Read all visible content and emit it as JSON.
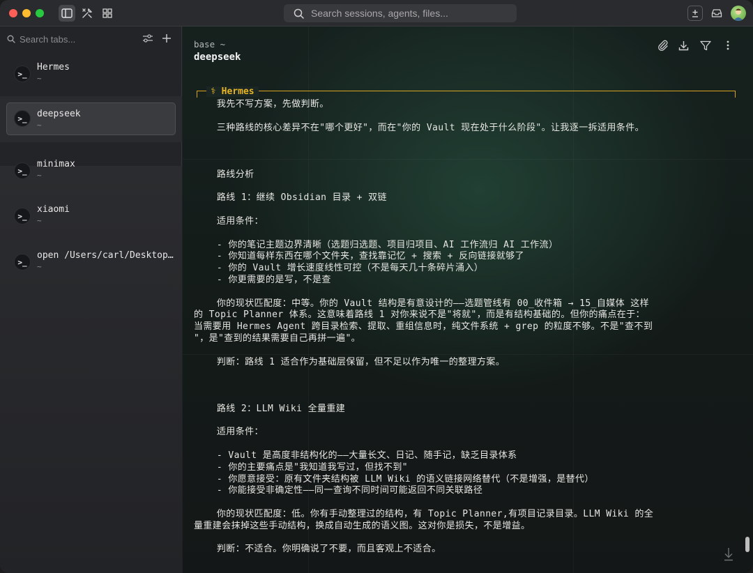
{
  "titlebar": {
    "search_placeholder": "Search sessions, agents, files..."
  },
  "sidebar": {
    "search_placeholder": "Search tabs...",
    "sessions": [
      {
        "icon": ">_",
        "name": "Hermes",
        "sub": "~"
      },
      {
        "icon": ">_",
        "name": "deepseek",
        "sub": "~"
      },
      {
        "icon": ">_",
        "name": "minimax",
        "sub": "~"
      },
      {
        "icon": ">_",
        "name": "xiaomi",
        "sub": "~"
      },
      {
        "icon": ">_",
        "name": "open /Users/carl/Desktop…",
        "sub": "~"
      }
    ],
    "selected": "deepseek"
  },
  "main": {
    "breadcrumb": "base ~",
    "title": "deepseek",
    "agent_label": "⚕ Hermes",
    "lines": [
      "    我先不写方案，先做判断。",
      "",
      "    三种路线的核心差异不在\"哪个更好\"，而在\"你的 Vault 现在处于什么阶段\"。让我逐一拆适用条件。",
      "",
      "",
      "",
      "    路线分析",
      "",
      "    路线 1：继续 Obsidian 目录 + 双链",
      "",
      "    适用条件：",
      "",
      "    - 你的笔记主题边界清晰（选题归选题、项目归项目、AI 工作流归 AI 工作流）",
      "    - 你知道每样东西在哪个文件夹，查找靠记忆 + 搜索 + 反向链接就够了",
      "    - 你的 Vault 增长速度线性可控（不是每天几十条碎片涌入）",
      "    - 你更需要的是写，不是查",
      "",
      "    你的现状匹配度：中等。你的 Vault 结构是有意设计的——选题管线有 00_收件箱 → 15_自媒体 这样",
      "的 Topic Planner 体系。这意味着路线 1 对你来说不是\"将就\"，而是有结构基础的。但你的痛点在于：",
      "当需要用 Hermes Agent 跨目录检索、提取、重组信息时，纯文件系统 + grep 的粒度不够。不是\"查不到",
      "\"，是\"查到的结果需要自己再拼一遍\"。",
      "",
      "    判断：路线 1 适合作为基础层保留，但不足以作为唯一的整理方案。",
      "",
      "",
      "",
      "    路线 2：LLM Wiki 全量重建",
      "",
      "    适用条件：",
      "",
      "    - Vault 是高度非结构化的——大量长文、日记、随手记，缺乏目录体系",
      "    - 你的主要痛点是\"我知道我写过，但找不到\"",
      "    - 你愿意接受：原有文件夹结构被 LLM Wiki 的语义链接网络替代（不是增强，是替代）",
      "    - 你能接受非确定性——同一查询不同时间可能返回不同关联路径",
      "",
      "    你的现状匹配度：低。你有手动整理过的结构，有 Topic Planner,有项目记录目录。LLM Wiki 的全",
      "量重建会抹掉这些手动结构，换成自动生成的语义图。这对你是损失，不是增益。",
      "",
      "    判断：不适合。你明确说了不要，而且客观上不适合。"
    ]
  },
  "colors": {
    "accent": "#e8b424",
    "traffic_red": "#ff5f57",
    "traffic_yellow": "#febc2e",
    "traffic_green": "#28c840"
  }
}
